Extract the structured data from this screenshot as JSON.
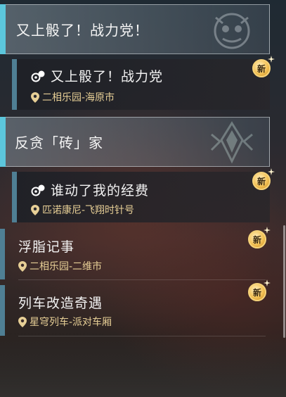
{
  "categories": [
    {
      "title": "又上骰了！战力党！"
    },
    {
      "title": "反贪「砖」家"
    }
  ],
  "quests": [
    {
      "name": "又上骰了！战力党",
      "location": "二相乐园-海原市",
      "badge": "新",
      "has_quest_icon": true
    },
    {
      "name": "谁动了我的经费",
      "location": "匹诺康尼-飞翔时针号",
      "badge": "新",
      "has_quest_icon": true
    },
    {
      "name": "浮脂记事",
      "location": "二相乐园-二维市",
      "badge": "新",
      "has_quest_icon": false
    },
    {
      "name": "列车改造奇遇",
      "location": "星穹列车-派对车厢",
      "badge": "新",
      "has_quest_icon": false
    }
  ],
  "colors": {
    "accent": "#5cc6dc",
    "location_text": "#e7cf96",
    "badge": "#f3c257"
  }
}
